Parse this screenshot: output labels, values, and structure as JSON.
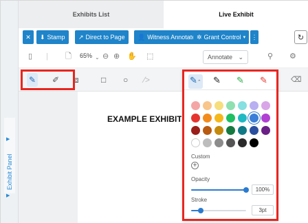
{
  "tabs": {
    "list": "Exhibits List",
    "live": "Live Exhibit"
  },
  "actions": {
    "close": "✕",
    "stamp": "Stamp",
    "direct_to_page": "Direct to Page",
    "witness_annotate": "Witness Annotate",
    "grant_control": "Grant Control",
    "more": "⋮",
    "refresh": "↻"
  },
  "viewbar": {
    "zoom": "65%",
    "annotate_mode": "Annotate"
  },
  "panel": {
    "label": "Exhibit Panel"
  },
  "document": {
    "title": "EXAMPLE EXHIBIT"
  },
  "popup": {
    "custom_label": "Custom",
    "opacity_label": "Opacity",
    "opacity_value": "100%",
    "opacity_fraction": 1.0,
    "stroke_label": "Stroke",
    "stroke_value": "3pt",
    "stroke_fraction": 0.18,
    "pen_colors": [
      "#1f6bb5",
      "#222222",
      "#2fae4b",
      "#e83a34"
    ],
    "swatch_rows": [
      [
        "#f4a6a6",
        "#f8c58a",
        "#f6de7c",
        "#8ee0b0",
        "#86dfe0",
        "#b8b0f0",
        "#d9a6e8"
      ],
      [
        "#e5342f",
        "#f28b1c",
        "#f5b81a",
        "#1fbf63",
        "#1fb9c3",
        "#3b7fd8",
        "#b13fd4"
      ],
      [
        "#9a1e1a",
        "#b85a10",
        "#c48a0c",
        "#157a40",
        "#127a86",
        "#2a4f9e",
        "#6a1f86"
      ],
      [
        "#ffffff",
        "#bdbdbd",
        "#8c8c8c",
        "#555555",
        "#2b2b2b",
        "#000000"
      ]
    ],
    "selected_swatch": "#3b7fd8"
  },
  "colors": {
    "accent": "#1f84c9",
    "highlight": "#e8251f"
  }
}
